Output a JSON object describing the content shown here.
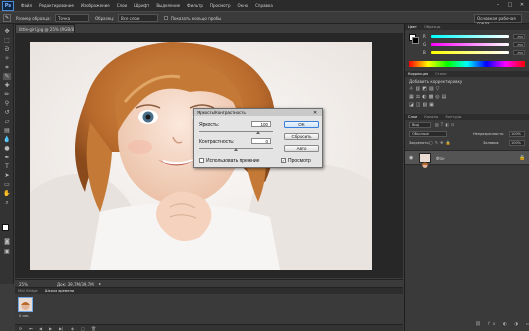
{
  "app": {
    "logo": "Ps"
  },
  "menu": [
    "Файл",
    "Редактирование",
    "Изображение",
    "Слои",
    "Шрифт",
    "Выделение",
    "Фильтр",
    "Просмотр",
    "Окно",
    "Справка"
  ],
  "options": {
    "sample_size_label": "Размер образца:",
    "sample_size_value": "Точка",
    "sample_label": "Образец:",
    "sample_value": "Все слои",
    "show_ring_label": "Показать кольцо пробы",
    "workspace": "Основная рабочая среда"
  },
  "document": {
    "tab_title": "little-girl.jpg @ 25% (RGB/8#) *",
    "zoom": "25%",
    "doc_info": "Док: 39,7M/39,7M"
  },
  "timeline": {
    "tabs": [
      "Mini Bridge",
      "Шкала времени"
    ],
    "frame_duration": "0 сек."
  },
  "panels": {
    "color_tabs": [
      "Цвет",
      "Образцы"
    ],
    "sliders": [
      {
        "label": "R",
        "value": "255",
        "color": "#e14b4b"
      },
      {
        "label": "G",
        "value": "255",
        "color": "#4bc24b"
      },
      {
        "label": "B",
        "value": "255",
        "color": "#4b6fe1"
      }
    ],
    "adjust_tabs": [
      "Коррекция",
      "Стили"
    ],
    "adjust_title": "Добавить корректировку",
    "layers_tabs": [
      "Слои",
      "Каналы",
      "Контуры"
    ],
    "layer_kind": "Вид",
    "blend_mode": "Обычные",
    "opacity_label": "Непрозрачность:",
    "opacity_value": "100%",
    "lock_label": "Закрепить:",
    "fill_label": "Заливка:",
    "fill_value": "100%",
    "layer_name": "Фон"
  },
  "dialog": {
    "title": "Яркость/Контрастность",
    "brightness_label": "Яркость:",
    "brightness_value": "100",
    "contrast_label": "Контрастность:",
    "contrast_value": "0",
    "ok": "OK",
    "reset": "Сбросить",
    "auto": "Авто",
    "legacy_label": "Использовать прежние",
    "preview_label": "Просмотр",
    "preview_check": "✓"
  },
  "colors": {
    "accent": "#3b7fd6",
    "bg": "#3c3c3c"
  }
}
